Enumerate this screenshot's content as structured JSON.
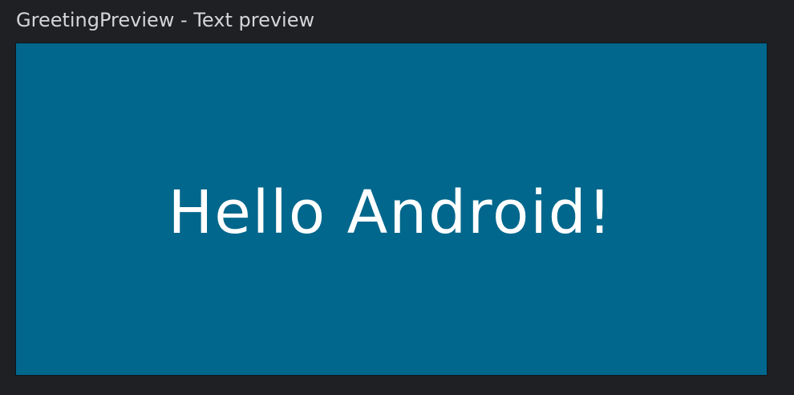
{
  "preview": {
    "title": "GreetingPreview - Text preview",
    "background_color": "#01678c",
    "text_color": "#ffffff"
  },
  "content": {
    "greeting": "Hello Android!"
  }
}
